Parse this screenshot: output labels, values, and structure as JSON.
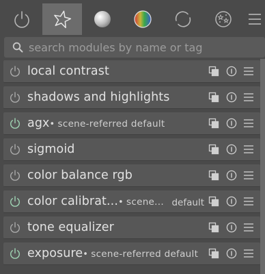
{
  "tabs": [
    {
      "name": "active-modules",
      "icon": "power-icon",
      "active": false
    },
    {
      "name": "favourite-modules",
      "icon": "star-icon",
      "active": true
    },
    {
      "name": "base-modules",
      "icon": "sphere-icon",
      "active": false
    },
    {
      "name": "color-modules",
      "icon": "color-wheel-icon",
      "active": false
    },
    {
      "name": "correct-modules",
      "icon": "rotate-icon",
      "active": false
    },
    {
      "name": "effect-modules",
      "icon": "effects-icon",
      "active": false
    },
    {
      "name": "presets-menu",
      "icon": "hamburger-icon",
      "active": false
    }
  ],
  "search": {
    "placeholder": "search modules by name or tag",
    "value": ""
  },
  "modules": [
    {
      "name": "local contrast",
      "enabled": false
    },
    {
      "name": "shadows and highlights",
      "enabled": false
    },
    {
      "name": "agx",
      "enabled": true,
      "label": "scene-referred default"
    },
    {
      "name": "sigmoid",
      "enabled": false
    },
    {
      "name": "color balance rgb",
      "enabled": false
    },
    {
      "name": "color calibrat...",
      "enabled": true,
      "label": "scene...",
      "instance": "default"
    },
    {
      "name": "tone equalizer",
      "enabled": false
    },
    {
      "name": "exposure",
      "enabled": true,
      "label": "scene-referred default"
    }
  ],
  "colors": {
    "background": "#4a4a4a",
    "row": "#575757",
    "active_tab": "#6c6c6c",
    "power_off": "#aaaaaa",
    "power_on": "#9fd4b4"
  }
}
